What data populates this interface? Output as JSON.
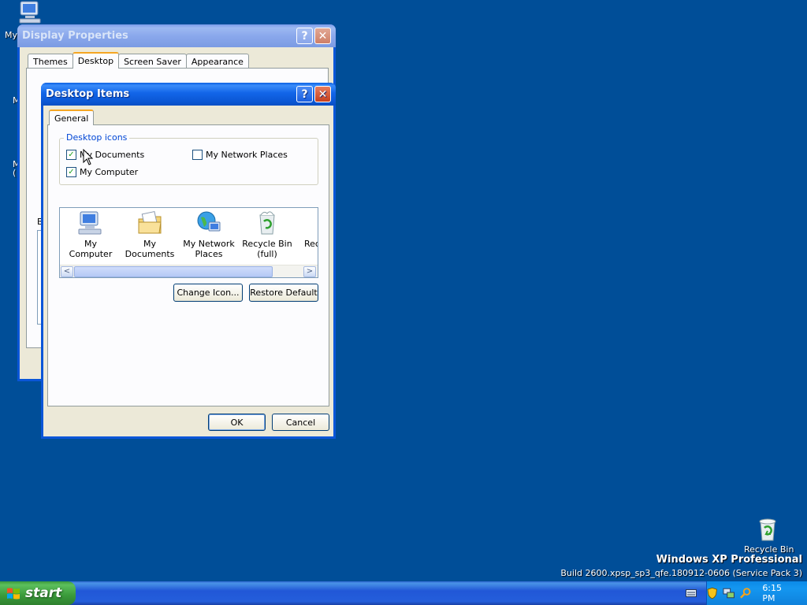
{
  "desktop": {
    "top_icon_label": "My",
    "side_labels": [
      "M",
      "M",
      "("
    ],
    "recycle_bin_label": "Recycle Bin",
    "branding_title": "Windows XP Professional",
    "branding_build": "Build 2600.xpsp_sp3_qfe.180912-0606 (Service Pack 3)"
  },
  "display_properties": {
    "title": "Display Properties",
    "help": "?",
    "close": "✕",
    "tabs": [
      "Themes",
      "Desktop",
      "Screen Saver",
      "Appearance"
    ],
    "active_tab": "Desktop",
    "partial_label": "B"
  },
  "desktop_items": {
    "title": "Desktop Items",
    "help": "?",
    "close": "✕",
    "tab": "General",
    "group_title": "Desktop icons",
    "checkboxes": [
      {
        "label": "My Documents",
        "checked": true
      },
      {
        "label": "My Computer",
        "checked": true
      },
      {
        "label": "My Network Places",
        "checked": false
      }
    ],
    "icons": [
      {
        "label": "My Computer",
        "icon": "my-computer-icon"
      },
      {
        "label": "My Documents",
        "icon": "my-documents-icon"
      },
      {
        "label": "My Network Places",
        "icon": "network-places-icon"
      },
      {
        "label": "Recycle Bin (full)",
        "icon": "recycle-bin-full-icon"
      },
      {
        "label": "Rec",
        "icon": "recycle-bin-empty-icon"
      }
    ],
    "scroll_left": "<",
    "scroll_right": ">",
    "change_icon": "Change Icon...",
    "restore_default": "Restore Default",
    "ok": "OK",
    "cancel": "Cancel"
  },
  "taskbar": {
    "start_label": "start",
    "clock": "6:15 PM"
  },
  "colors": {
    "desktop_bg": "#004e98",
    "title_active": "#0a5fe2",
    "window_face": "#ece9d8",
    "start_green": "#3c9a3c"
  }
}
